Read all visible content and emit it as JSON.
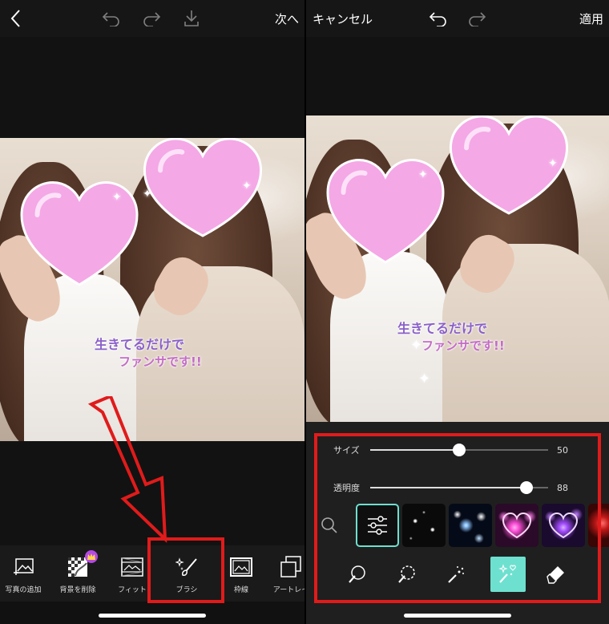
{
  "left": {
    "topbar": {
      "back_icon": "chevron-left-icon",
      "undo_icon": "undo-icon",
      "redo_icon": "redo-icon",
      "download_icon": "download-icon",
      "next_label": "次へ"
    },
    "sticker": {
      "line1": "生きてるだけで",
      "line2": "ファンサです!!"
    },
    "tools": [
      {
        "label": "写真の追加",
        "icon": "add-photo-icon"
      },
      {
        "label": "背景を削除",
        "icon": "remove-background-icon"
      },
      {
        "label": "フィット",
        "icon": "fit-icon"
      },
      {
        "label": "ブラシ",
        "icon": "brush-icon"
      },
      {
        "label": "枠線",
        "icon": "border-icon"
      },
      {
        "label": "アートレイ",
        "icon": "art-layer-icon"
      }
    ]
  },
  "right": {
    "topbar": {
      "cancel_label": "キャンセル",
      "undo_icon": "undo-icon",
      "redo_icon": "redo-icon",
      "apply_label": "適用"
    },
    "sticker": {
      "line1": "生きてるだけで",
      "line2": "ファンサです!!"
    },
    "size": {
      "label": "サイズ",
      "value": "50",
      "level": 0.5
    },
    "opacity": {
      "label": "透明度",
      "value": "88",
      "level": 0.88
    },
    "brushes": [
      {
        "name": "brush-settings",
        "selected": true
      },
      {
        "name": "white-stars",
        "selected": false
      },
      {
        "name": "blue-sparkle-stars",
        "selected": false
      },
      {
        "name": "pink-neon-hearts",
        "selected": false
      },
      {
        "name": "purple-neon-hearts",
        "selected": false
      },
      {
        "name": "red-hearts",
        "selected": false
      }
    ],
    "modes": [
      {
        "icon": "brush-mode-icon"
      },
      {
        "icon": "dashed-brush-icon"
      },
      {
        "icon": "sparkle-brush-icon"
      },
      {
        "icon": "magic-brush-icon",
        "active": true
      },
      {
        "icon": "eraser-icon"
      }
    ]
  },
  "colors": {
    "highlight_red": "#e01b1b",
    "accent_teal": "#6ee0cf",
    "heart_pink": "#f4a8e6"
  }
}
